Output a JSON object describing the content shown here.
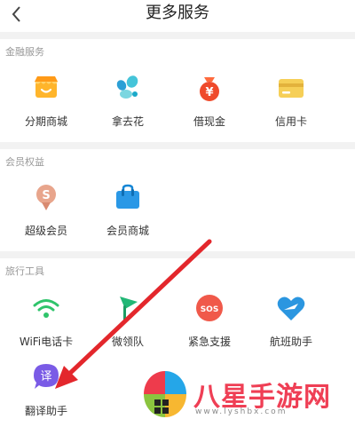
{
  "header": {
    "title": "更多服务",
    "back_icon": "chevron-left-icon"
  },
  "sections": [
    {
      "title": "金融服务",
      "items": [
        {
          "label": "分期商城",
          "icon": "shop-awning-icon"
        },
        {
          "label": "拿去花",
          "icon": "flower-icon"
        },
        {
          "label": "借现金",
          "icon": "money-bag-icon"
        },
        {
          "label": "信用卡",
          "icon": "card-icon"
        }
      ]
    },
    {
      "title": "会员权益",
      "items": [
        {
          "label": "超级会员",
          "icon": "super-member-icon"
        },
        {
          "label": "会员商城",
          "icon": "shopping-bag-icon"
        }
      ]
    },
    {
      "title": "旅行工具",
      "items": [
        {
          "label": "WiFi电话卡",
          "icon": "wifi-icon"
        },
        {
          "label": "微领队",
          "icon": "flag-icon"
        },
        {
          "label": "紧急支援",
          "icon": "sos-icon"
        },
        {
          "label": "航班助手",
          "icon": "flight-heart-icon"
        }
      ]
    },
    {
      "title": "",
      "items": [
        {
          "label": "翻译助手",
          "icon": "translate-chat-icon",
          "glyph": "译"
        }
      ]
    }
  ],
  "watermark": {
    "text": "八星手游网",
    "url": "www.lyshbx.com"
  },
  "colors": {
    "background": "#ffffff",
    "section_band": "#f2f2f2",
    "annotation_arrow": "#e3272c",
    "watermark": "#ef3f55"
  }
}
